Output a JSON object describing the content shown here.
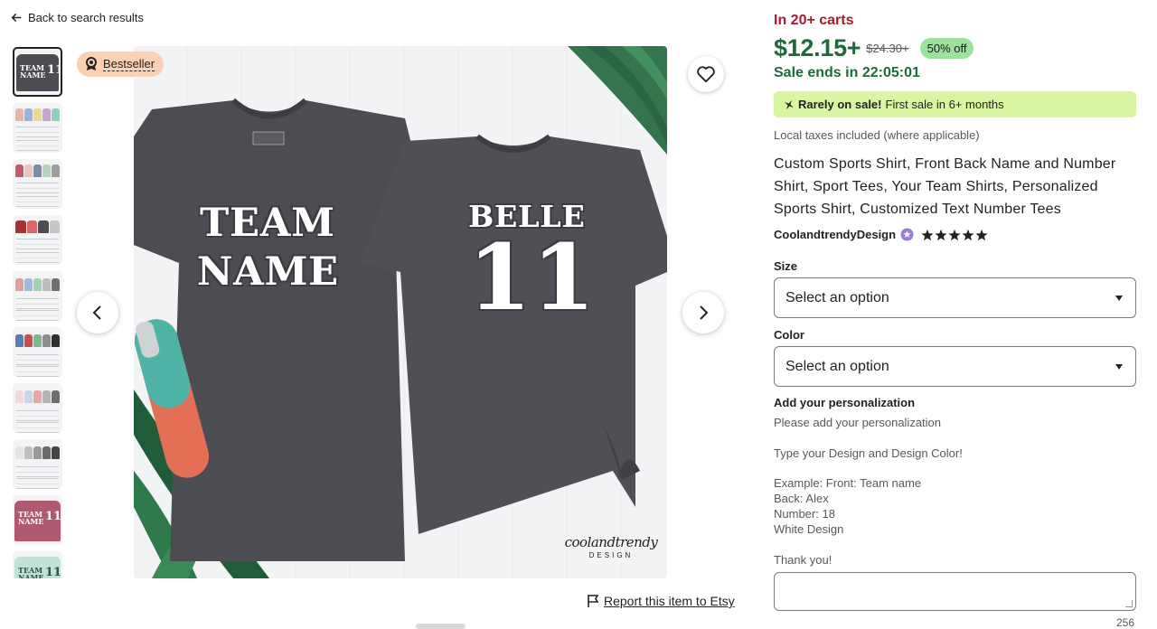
{
  "back": {
    "label": "Back to search results"
  },
  "badge": {
    "label": "Bestseller"
  },
  "image": {
    "front_line1": "TEAM",
    "front_line2": "NAME",
    "back_name": "BELLE",
    "back_number": "11",
    "watermark_script": "coolandtrendy",
    "watermark_design": "DESIGN",
    "neck_label": "coolandtrendy"
  },
  "thumbnails": [
    {
      "label": "TEAM NAME 11",
      "kind": "shirt",
      "color": "#4b4d52"
    },
    {
      "kind": "swatches",
      "colors": [
        "#e8b4a8",
        "#9bb3d4",
        "#f0d98a",
        "#c5a7d6",
        "#8fcfc0",
        "#d9d9d9"
      ]
    },
    {
      "kind": "swatches",
      "colors": [
        "#c25a6b",
        "#e8c4c4",
        "#7b8ca8",
        "#b8d4c0",
        "#e0c9a6",
        "#9e9e9e"
      ]
    },
    {
      "kind": "swatches",
      "colors": [
        "#a83232",
        "#d66a6a",
        "#4b4d52",
        "#c7c7c7",
        "#e8e8e8",
        "#333"
      ]
    },
    {
      "kind": "swatches",
      "colors": [
        "#e0a0a0",
        "#a0b8e0",
        "#9fd4b8",
        "#d4c09f",
        "#bcbcbc",
        "#6f6f6f"
      ]
    },
    {
      "kind": "swatches",
      "colors": [
        "#5a7bb5",
        "#c94d4d",
        "#7fb58f",
        "#d9a066",
        "#8c8c8c",
        "#2f2f2f"
      ]
    },
    {
      "kind": "swatches",
      "colors": [
        "#f3d9dc",
        "#c9d6ea",
        "#e8a6a6",
        "#b5b5b5",
        "#6e6e6e",
        "#2b2b2b"
      ]
    },
    {
      "kind": "swatches",
      "colors": [
        "#e5e5e5",
        "#bfbfbf",
        "#9a9a9a",
        "#6a6a6a",
        "#444",
        "#222"
      ]
    },
    {
      "label": "TEAM NAME 11",
      "kind": "shirt",
      "color": "#b05a72"
    },
    {
      "label": "TEAM NAME 11",
      "kind": "shirt",
      "color": "#bfe3d6"
    }
  ],
  "product": {
    "carts": "In 20+ carts",
    "price": "$12.15+",
    "old_price": "$24.30+",
    "discount": "50% off",
    "sale_ends": "Sale ends in 22:05:01",
    "rare_bold": "Rarely on sale!",
    "rare_text": "First sale in 6+ months",
    "taxes": "Local taxes included (where applicable)",
    "title": "Custom Sports Shirt, Front Back Name and Number Shirt, Sport Tees, Your Team Shirts, Personalized Sports Shirt, Customized Text Number Tees",
    "shop": "CoolandtrendyDesign",
    "rating": 5
  },
  "options": {
    "size_label": "Size",
    "size_value": "Select an option",
    "color_label": "Color",
    "color_value": "Select an option"
  },
  "personalization": {
    "heading": "Add your personalization",
    "line1": "Please add your personalization",
    "line2": "Type your Design and Design Color!",
    "line3": "Example: Front: Team name",
    "line4": "Back: Alex",
    "line5": "Number: 18",
    "line6": "White Design",
    "line7": "Thank you!",
    "counter": "256"
  },
  "report": {
    "label": "Report this item to Etsy"
  },
  "colors": {
    "sale_green": "#1e6b3a",
    "carts_red": "#a61a2e",
    "badge_peach": "#fcd0b4",
    "off_green": "#9ee19e",
    "rare_bg": "#d8f5a2"
  }
}
